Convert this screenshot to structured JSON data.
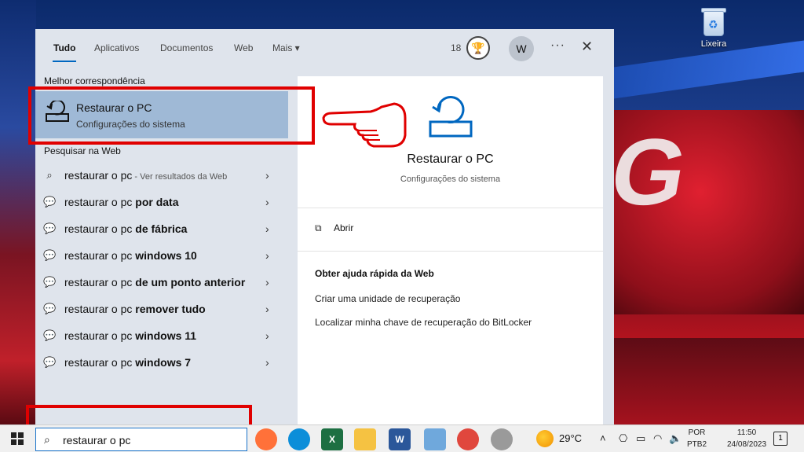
{
  "desktop": {
    "recycle_bin_label": "Lixeira"
  },
  "panel": {
    "tabs": [
      {
        "label": "Tudo"
      },
      {
        "label": "Aplicativos"
      },
      {
        "label": "Documentos"
      },
      {
        "label": "Web"
      },
      {
        "label": "Mais ▾"
      }
    ],
    "points": "18",
    "avatar_initial": "W",
    "more_glyph": "···",
    "close_glyph": "✕",
    "best_match_header": "Melhor correspondência",
    "best_match": {
      "title": "Restaurar o PC",
      "subtitle": "Configurações do sistema"
    },
    "web_header": "Pesquisar na Web",
    "web_results": [
      {
        "prefix": "restaurar o pc",
        "bold": "",
        "hint": " - Ver resultados da Web",
        "icon": "search-icon"
      },
      {
        "prefix": "restaurar o pc ",
        "bold": "por data",
        "hint": "",
        "icon": "chat-icon"
      },
      {
        "prefix": "restaurar o pc ",
        "bold": "de fábrica",
        "hint": "",
        "icon": "chat-icon"
      },
      {
        "prefix": "restaurar o pc ",
        "bold": "windows 10",
        "hint": "",
        "icon": "chat-icon"
      },
      {
        "prefix": "restaurar o pc ",
        "bold": "de um ponto anterior",
        "hint": "",
        "icon": "chat-icon"
      },
      {
        "prefix": "restaurar o pc ",
        "bold": "remover tudo",
        "hint": "",
        "icon": "chat-icon"
      },
      {
        "prefix": "restaurar o pc ",
        "bold": "windows 11",
        "hint": "",
        "icon": "chat-icon"
      },
      {
        "prefix": "restaurar o pc ",
        "bold": "windows 7",
        "hint": "",
        "icon": "chat-icon"
      }
    ],
    "detail": {
      "title": "Restaurar o PC",
      "subtitle": "Configurações do sistema",
      "open_label": "Abrir",
      "help_header": "Obter ajuda rápida da Web",
      "links": [
        "Criar uma unidade de recuperação",
        "Localizar minha chave de recuperação do BitLocker"
      ]
    }
  },
  "taskbar": {
    "search_value": "restaurar o pc",
    "temperature": "29°C",
    "language": "POR",
    "keyboard": "PTB2",
    "time": "11:50",
    "date": "24/08/2023",
    "notifications": "1",
    "apps": [
      {
        "name": "firefox-icon",
        "color": "#ff7139",
        "glyph": ""
      },
      {
        "name": "edge-icon",
        "color": "#0c8ed9",
        "glyph": ""
      },
      {
        "name": "excel-icon",
        "color": "#1d6f42",
        "glyph": "X"
      },
      {
        "name": "file-explorer-icon",
        "color": "#f5c242",
        "glyph": ""
      },
      {
        "name": "word-icon",
        "color": "#2b579a",
        "glyph": "W"
      },
      {
        "name": "notepad-app-icon",
        "color": "#6fa8dc",
        "glyph": ""
      },
      {
        "name": "snipping-tool-icon",
        "color": "#e0473d",
        "glyph": ""
      },
      {
        "name": "paint-app-icon",
        "color": "#9a9a9a",
        "glyph": ""
      }
    ]
  },
  "colors": {
    "accent": "#0067c0",
    "selection": "#9fb9d6",
    "annotation_red": "#e00000"
  }
}
